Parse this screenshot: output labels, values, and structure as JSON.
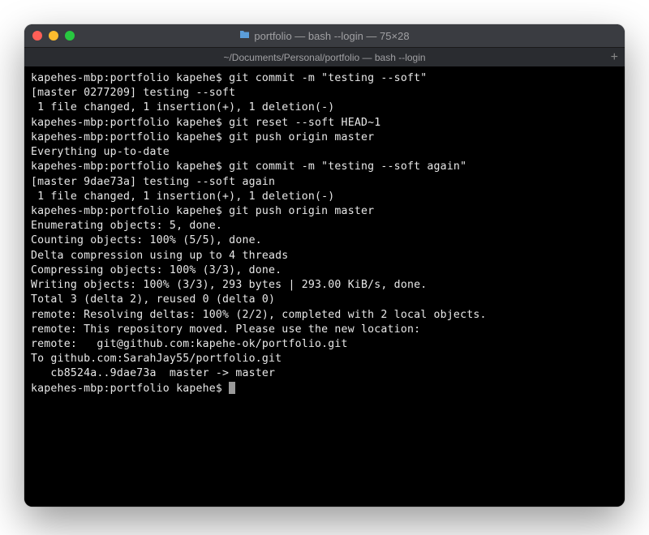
{
  "titlebar": {
    "title": "portfolio — bash --login — 75×28"
  },
  "tabbar": {
    "tab_title": "~/Documents/Personal/portfolio — bash --login",
    "plus": "+"
  },
  "terminal": {
    "lines": [
      "kapehes-mbp:portfolio kapehe$ git commit -m \"testing --soft\"",
      "[master 0277209] testing --soft",
      " 1 file changed, 1 insertion(+), 1 deletion(-)",
      "kapehes-mbp:portfolio kapehe$ git reset --soft HEAD~1",
      "kapehes-mbp:portfolio kapehe$ git push origin master",
      "Everything up-to-date",
      "kapehes-mbp:portfolio kapehe$ git commit -m \"testing --soft again\"",
      "[master 9dae73a] testing --soft again",
      " 1 file changed, 1 insertion(+), 1 deletion(-)",
      "kapehes-mbp:portfolio kapehe$ git push origin master",
      "Enumerating objects: 5, done.",
      "Counting objects: 100% (5/5), done.",
      "Delta compression using up to 4 threads",
      "Compressing objects: 100% (3/3), done.",
      "Writing objects: 100% (3/3), 293 bytes | 293.00 KiB/s, done.",
      "Total 3 (delta 2), reused 0 (delta 0)",
      "remote: Resolving deltas: 100% (2/2), completed with 2 local objects.",
      "remote: This repository moved. Please use the new location:",
      "remote:   git@github.com:kapehe-ok/portfolio.git",
      "To github.com:SarahJay55/portfolio.git",
      "   cb8524a..9dae73a  master -> master",
      "kapehes-mbp:portfolio kapehe$ "
    ]
  }
}
